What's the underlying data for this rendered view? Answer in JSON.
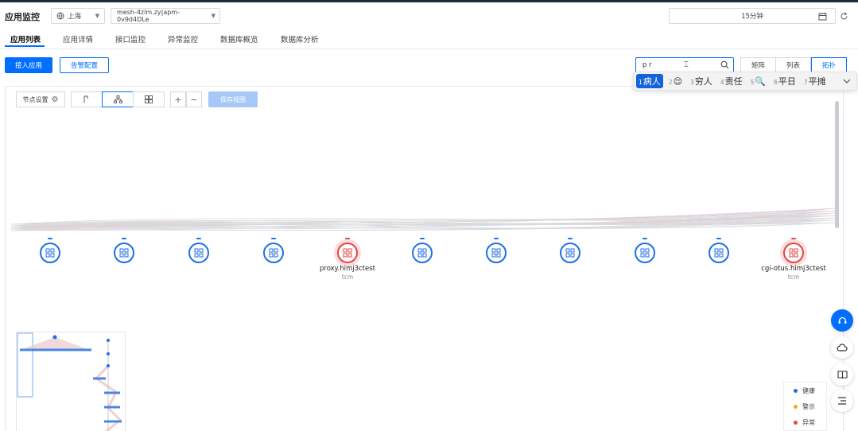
{
  "app_title": "应用监控",
  "region": {
    "value": "上海"
  },
  "instance": {
    "value": "mesh-4zlm.zy|apm-0v9d4DLe"
  },
  "time_range": {
    "value": "15分钟"
  },
  "tabs": [
    {
      "label": "应用列表"
    },
    {
      "label": "应用详情"
    },
    {
      "label": "接口监控"
    },
    {
      "label": "异常监控"
    },
    {
      "label": "数据库概览"
    },
    {
      "label": "数据库分析"
    }
  ],
  "actions": {
    "connect_label": "接入应用",
    "alert_label": "告警配置"
  },
  "search": {
    "value": "p r"
  },
  "view_modes": [
    {
      "label": "矩阵"
    },
    {
      "label": "列表"
    },
    {
      "label": "拓扑"
    }
  ],
  "ime": {
    "candidates": [
      {
        "num": "1",
        "text": "病人"
      },
      {
        "num": "2",
        "text": "😌"
      },
      {
        "num": "3",
        "text": "穷人"
      },
      {
        "num": "4",
        "text": "责任"
      },
      {
        "num": "5",
        "text": "🔍"
      },
      {
        "num": "6",
        "text": "平日"
      },
      {
        "num": "7",
        "text": "平摊"
      }
    ]
  },
  "toolbar": {
    "layout_settings_label": "节点设置",
    "save_label": "保存视图"
  },
  "nodes": [
    {
      "status": "normal",
      "label": "",
      "sub": ""
    },
    {
      "status": "normal",
      "label": "",
      "sub": ""
    },
    {
      "status": "normal",
      "label": "",
      "sub": ""
    },
    {
      "status": "normal",
      "label": "",
      "sub": ""
    },
    {
      "status": "error",
      "label": "proxy.himj3ctest",
      "sub": "tcm"
    },
    {
      "status": "normal",
      "label": "",
      "sub": ""
    },
    {
      "status": "normal",
      "label": "",
      "sub": ""
    },
    {
      "status": "normal",
      "label": "",
      "sub": ""
    },
    {
      "status": "normal",
      "label": "",
      "sub": ""
    },
    {
      "status": "normal",
      "label": "",
      "sub": ""
    },
    {
      "status": "error",
      "label": "cgi-otus.himj3ctest",
      "sub": "tcm"
    }
  ],
  "legend": [
    {
      "label": "健康",
      "color": "#1d6fe8"
    },
    {
      "label": "警示",
      "color": "#f5a623"
    },
    {
      "label": "异常",
      "color": "#e54545"
    }
  ],
  "colors": {
    "accent": "#006eff",
    "error": "#e54545"
  }
}
